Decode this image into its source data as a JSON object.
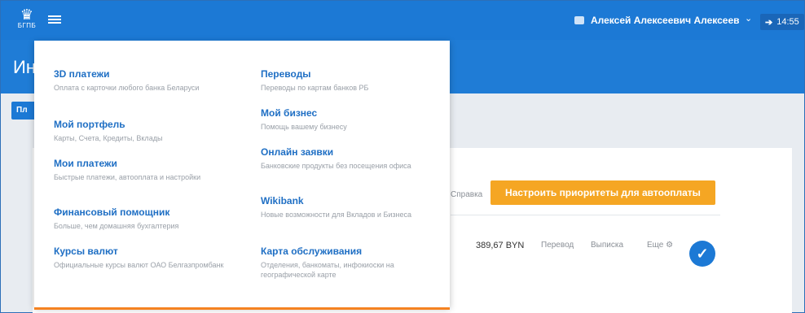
{
  "topbar": {
    "logo_text": "БГПБ",
    "user_name": "Алексей Алексеевич Алексеев",
    "time": "14:55"
  },
  "banner": {
    "title": "Ин"
  },
  "blue_button": {
    "label": "Пл"
  },
  "content": {
    "help_link": "Справка",
    "autopay_button": "Настроить приоритеты для автооплаты",
    "account": {
      "amount": "389,67 BYN",
      "transfer": "Перевод",
      "statement": "Выписка",
      "more": "Еще ⚙"
    }
  },
  "menu": {
    "left": [
      {
        "title": "3D платежи",
        "desc": "Оплата с карточки любого банка Беларуси"
      },
      {
        "title": "Мой портфель",
        "desc": "Карты, Счета, Кредиты, Вклады"
      },
      {
        "title": "Мои платежи",
        "desc": "Быстрые платежи, автооплата и настройки"
      },
      {
        "title": "Финансовый помощник",
        "desc": "Больше, чем домашняя бухгалтерия"
      },
      {
        "title": "Курсы валют",
        "desc": "Официальные курсы валют ОАО Белгазпромбанк"
      }
    ],
    "right": [
      {
        "title": "Переводы",
        "desc": "Переводы по картам банков РБ"
      },
      {
        "title": "Мой бизнес",
        "desc": "Помощь вашему бизнесу"
      },
      {
        "title": "Онлайн заявки",
        "desc": "Банковские продукты без посещения офиса"
      },
      {
        "title": "Wikibank",
        "desc": "Новые возможности для Вкладов и Бизнеса"
      },
      {
        "title": "Карта обслуживания",
        "desc": "Отделения, банкоматы, инфокиоски на географической карте"
      }
    ]
  },
  "colors": {
    "primary": "#1c79d5",
    "accent": "#f5a623",
    "link": "#1f6fc4"
  },
  "icons": {
    "menu": "hamburger-icon",
    "user": "user-card-icon",
    "logout": "logout-icon",
    "check": "check-icon"
  }
}
